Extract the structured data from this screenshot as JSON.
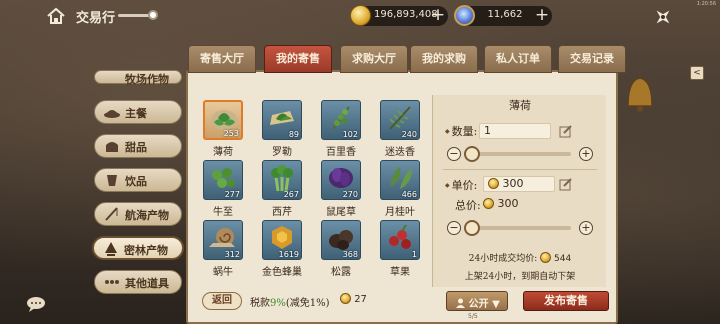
{
  "topbar": {
    "title": "交易行",
    "gold": "196,893,408",
    "gems": "11,662",
    "clock": "1:20:56"
  },
  "tabs": [
    {
      "label": "寄售大厅",
      "active": false
    },
    {
      "label": "我的寄售",
      "active": true
    },
    {
      "label": "求购大厅",
      "active": false
    },
    {
      "label": "我的求购",
      "active": false
    },
    {
      "label": "私人订单",
      "active": false
    },
    {
      "label": "交易记录",
      "active": false
    }
  ],
  "categories": [
    {
      "label": "牧场作物",
      "active": false
    },
    {
      "label": "主餐",
      "active": false
    },
    {
      "label": "甜品",
      "active": false
    },
    {
      "label": "饮品",
      "active": false
    },
    {
      "label": "航海产物",
      "active": false
    },
    {
      "label": "密林产物",
      "active": true
    },
    {
      "label": "其他道具",
      "active": false
    }
  ],
  "items": [
    {
      "name": "薄荷",
      "count": "253",
      "icon": "mint-icon",
      "selected": true
    },
    {
      "name": "罗勒",
      "count": "89",
      "icon": "basil-icon",
      "selected": false
    },
    {
      "name": "百里香",
      "count": "102",
      "icon": "thyme-icon",
      "selected": false
    },
    {
      "name": "迷迭香",
      "count": "240",
      "icon": "rosemary-icon",
      "selected": false
    },
    {
      "name": "牛至",
      "count": "277",
      "icon": "oregano-icon",
      "selected": false
    },
    {
      "name": "西芹",
      "count": "267",
      "icon": "celery-icon",
      "selected": false
    },
    {
      "name": "鼠尾草",
      "count": "270",
      "icon": "sage-icon",
      "selected": false
    },
    {
      "name": "月桂叶",
      "count": "466",
      "icon": "bay-leaf-icon",
      "selected": false
    },
    {
      "name": "蜗牛",
      "count": "312",
      "icon": "snail-icon",
      "selected": false
    },
    {
      "name": "金色蜂巢",
      "count": "1619",
      "icon": "golden-honeycomb-icon",
      "selected": false
    },
    {
      "name": "松露",
      "count": "368",
      "icon": "truffle-icon",
      "selected": false
    },
    {
      "name": "草果",
      "count": "1",
      "icon": "tsaoko-icon",
      "selected": false
    }
  ],
  "detail": {
    "item_name": "薄荷",
    "quantity_label": "数量:",
    "quantity_value": "1",
    "quantity_level": 0.05,
    "unit_price_label": "单价:",
    "unit_price_value": "300",
    "total_price_label": "总价:",
    "total_price_value": "300",
    "price_level": 0.05,
    "avg_price_label": "24小时成交均价:",
    "avg_price_value": "544",
    "notice": "上架24小时，到期自动下架"
  },
  "footer": {
    "back_label": "返回",
    "tax_prefix": "税款",
    "tax_percent": "9%",
    "tax_suffix": "(减免1%)",
    "fee": "27",
    "public_label": "公开",
    "publish_label": "发布寄售",
    "page": "5/5"
  },
  "colors": {
    "accent_red": "#a53e2a",
    "panel_bg": "#efe5d3",
    "tax_green": "#3c8a2a"
  }
}
